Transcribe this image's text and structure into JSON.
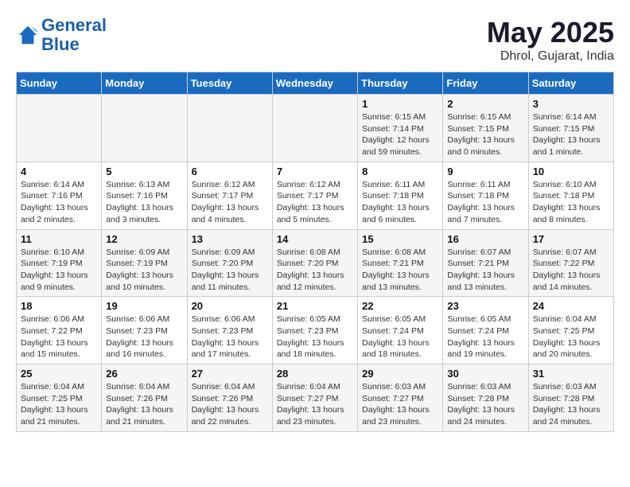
{
  "header": {
    "logo_line1": "General",
    "logo_line2": "Blue",
    "month": "May 2025",
    "location": "Dhrol, Gujarat, India"
  },
  "days_of_week": [
    "Sunday",
    "Monday",
    "Tuesday",
    "Wednesday",
    "Thursday",
    "Friday",
    "Saturday"
  ],
  "weeks": [
    [
      {
        "day": "",
        "info": ""
      },
      {
        "day": "",
        "info": ""
      },
      {
        "day": "",
        "info": ""
      },
      {
        "day": "",
        "info": ""
      },
      {
        "day": "1",
        "info": "Sunrise: 6:15 AM\nSunset: 7:14 PM\nDaylight: 12 hours\nand 59 minutes."
      },
      {
        "day": "2",
        "info": "Sunrise: 6:15 AM\nSunset: 7:15 PM\nDaylight: 13 hours\nand 0 minutes."
      },
      {
        "day": "3",
        "info": "Sunrise: 6:14 AM\nSunset: 7:15 PM\nDaylight: 13 hours\nand 1 minute."
      }
    ],
    [
      {
        "day": "4",
        "info": "Sunrise: 6:14 AM\nSunset: 7:16 PM\nDaylight: 13 hours\nand 2 minutes."
      },
      {
        "day": "5",
        "info": "Sunrise: 6:13 AM\nSunset: 7:16 PM\nDaylight: 13 hours\nand 3 minutes."
      },
      {
        "day": "6",
        "info": "Sunrise: 6:12 AM\nSunset: 7:17 PM\nDaylight: 13 hours\nand 4 minutes."
      },
      {
        "day": "7",
        "info": "Sunrise: 6:12 AM\nSunset: 7:17 PM\nDaylight: 13 hours\nand 5 minutes."
      },
      {
        "day": "8",
        "info": "Sunrise: 6:11 AM\nSunset: 7:18 PM\nDaylight: 13 hours\nand 6 minutes."
      },
      {
        "day": "9",
        "info": "Sunrise: 6:11 AM\nSunset: 7:18 PM\nDaylight: 13 hours\nand 7 minutes."
      },
      {
        "day": "10",
        "info": "Sunrise: 6:10 AM\nSunset: 7:18 PM\nDaylight: 13 hours\nand 8 minutes."
      }
    ],
    [
      {
        "day": "11",
        "info": "Sunrise: 6:10 AM\nSunset: 7:19 PM\nDaylight: 13 hours\nand 9 minutes."
      },
      {
        "day": "12",
        "info": "Sunrise: 6:09 AM\nSunset: 7:19 PM\nDaylight: 13 hours\nand 10 minutes."
      },
      {
        "day": "13",
        "info": "Sunrise: 6:09 AM\nSunset: 7:20 PM\nDaylight: 13 hours\nand 11 minutes."
      },
      {
        "day": "14",
        "info": "Sunrise: 6:08 AM\nSunset: 7:20 PM\nDaylight: 13 hours\nand 12 minutes."
      },
      {
        "day": "15",
        "info": "Sunrise: 6:08 AM\nSunset: 7:21 PM\nDaylight: 13 hours\nand 13 minutes."
      },
      {
        "day": "16",
        "info": "Sunrise: 6:07 AM\nSunset: 7:21 PM\nDaylight: 13 hours\nand 13 minutes."
      },
      {
        "day": "17",
        "info": "Sunrise: 6:07 AM\nSunset: 7:22 PM\nDaylight: 13 hours\nand 14 minutes."
      }
    ],
    [
      {
        "day": "18",
        "info": "Sunrise: 6:06 AM\nSunset: 7:22 PM\nDaylight: 13 hours\nand 15 minutes."
      },
      {
        "day": "19",
        "info": "Sunrise: 6:06 AM\nSunset: 7:23 PM\nDaylight: 13 hours\nand 16 minutes."
      },
      {
        "day": "20",
        "info": "Sunrise: 6:06 AM\nSunset: 7:23 PM\nDaylight: 13 hours\nand 17 minutes."
      },
      {
        "day": "21",
        "info": "Sunrise: 6:05 AM\nSunset: 7:23 PM\nDaylight: 13 hours\nand 18 minutes."
      },
      {
        "day": "22",
        "info": "Sunrise: 6:05 AM\nSunset: 7:24 PM\nDaylight: 13 hours\nand 18 minutes."
      },
      {
        "day": "23",
        "info": "Sunrise: 6:05 AM\nSunset: 7:24 PM\nDaylight: 13 hours\nand 19 minutes."
      },
      {
        "day": "24",
        "info": "Sunrise: 6:04 AM\nSunset: 7:25 PM\nDaylight: 13 hours\nand 20 minutes."
      }
    ],
    [
      {
        "day": "25",
        "info": "Sunrise: 6:04 AM\nSunset: 7:25 PM\nDaylight: 13 hours\nand 21 minutes."
      },
      {
        "day": "26",
        "info": "Sunrise: 6:04 AM\nSunset: 7:26 PM\nDaylight: 13 hours\nand 21 minutes."
      },
      {
        "day": "27",
        "info": "Sunrise: 6:04 AM\nSunset: 7:26 PM\nDaylight: 13 hours\nand 22 minutes."
      },
      {
        "day": "28",
        "info": "Sunrise: 6:04 AM\nSunset: 7:27 PM\nDaylight: 13 hours\nand 23 minutes."
      },
      {
        "day": "29",
        "info": "Sunrise: 6:03 AM\nSunset: 7:27 PM\nDaylight: 13 hours\nand 23 minutes."
      },
      {
        "day": "30",
        "info": "Sunrise: 6:03 AM\nSunset: 7:28 PM\nDaylight: 13 hours\nand 24 minutes."
      },
      {
        "day": "31",
        "info": "Sunrise: 6:03 AM\nSunset: 7:28 PM\nDaylight: 13 hours\nand 24 minutes."
      }
    ]
  ]
}
